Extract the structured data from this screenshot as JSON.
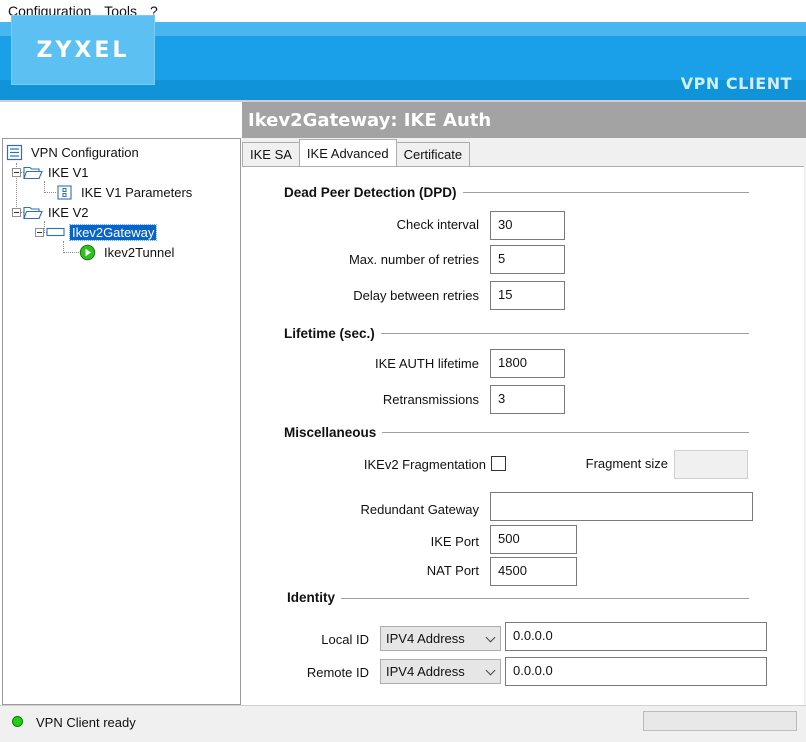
{
  "menu": [
    "Configuration",
    "Tools",
    "?"
  ],
  "brand": {
    "logo": "ZYXEL",
    "product": "VPN CLIENT",
    "accent": "#1aa0e8"
  },
  "tree": {
    "root": "VPN Configuration",
    "ike_v1": "IKE V1",
    "ike_v1_params": "IKE V1 Parameters",
    "ike_v2": "IKE V2",
    "gateway": "Ikev2Gateway",
    "tunnel": "Ikev2Tunnel"
  },
  "panel": {
    "title": "Ikev2Gateway: IKE Auth",
    "tabs": [
      "IKE SA",
      "IKE Advanced",
      "Certificate"
    ],
    "active_tab": "IKE Advanced"
  },
  "dpd": {
    "title": "Dead Peer Detection (DPD)",
    "check_interval_label": "Check interval",
    "check_interval": "30",
    "max_retries_label": "Max. number of retries",
    "max_retries": "5",
    "delay_label": "Delay between retries",
    "delay": "15"
  },
  "lifetime": {
    "title": "Lifetime (sec.)",
    "ike_auth_label": "IKE AUTH lifetime",
    "ike_auth": "1800",
    "retrans_label": "Retransmissions",
    "retrans": "3"
  },
  "misc": {
    "title": "Miscellaneous",
    "frag_label": "IKEv2 Fragmentation",
    "frag_checked": false,
    "frag_size_label": "Fragment size",
    "frag_size": "",
    "redundant_label": "Redundant Gateway",
    "redundant": "",
    "ike_port_label": "IKE Port",
    "ike_port": "500",
    "nat_port_label": "NAT Port",
    "nat_port": "4500"
  },
  "identity": {
    "title": "Identity",
    "local_label": "Local ID",
    "local_type": "IPV4 Address",
    "local_value": "0.0.0.0",
    "remote_label": "Remote ID",
    "remote_type": "IPV4 Address",
    "remote_value": "0.0.0.0"
  },
  "status": {
    "text": "VPN Client ready",
    "indicator_color": "#1fd20f"
  }
}
